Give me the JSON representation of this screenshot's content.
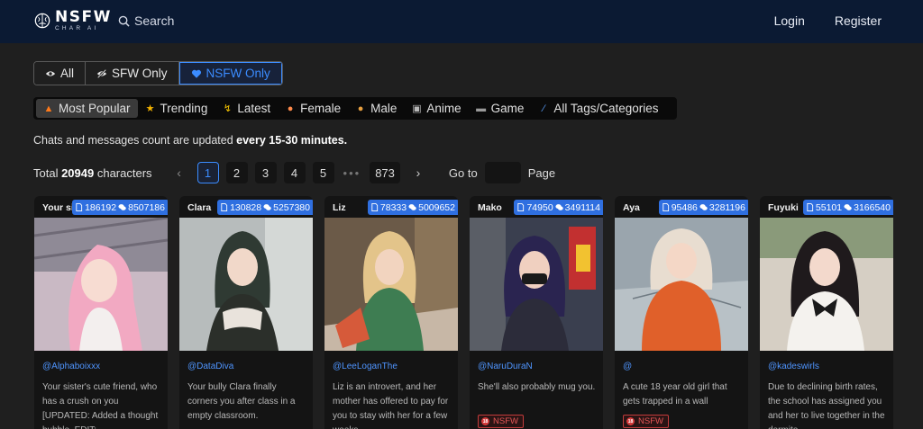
{
  "header": {
    "logo_main": "NSFW",
    "logo_sub": "CHAR AI",
    "search_label": "Search",
    "login": "Login",
    "register": "Register"
  },
  "filters": [
    {
      "label": "All",
      "icon": "eye-icon",
      "active": false
    },
    {
      "label": "SFW Only",
      "icon": "eye-off-icon",
      "active": false
    },
    {
      "label": "NSFW Only",
      "icon": "heart-icon",
      "active": true
    }
  ],
  "sort_tabs": [
    {
      "label": "Most Popular",
      "icon": "fire-icon",
      "active": true
    },
    {
      "label": "Trending",
      "icon": "star-icon",
      "active": false
    },
    {
      "label": "Latest",
      "icon": "lightning-icon",
      "active": false
    },
    {
      "label": "Female",
      "icon": "female-face-icon",
      "active": false
    },
    {
      "label": "Male",
      "icon": "male-face-icon",
      "active": false
    },
    {
      "label": "Anime",
      "icon": "tv-icon",
      "active": false
    },
    {
      "label": "Game",
      "icon": "gamepad-icon",
      "active": false
    },
    {
      "label": "All Tags/Categories",
      "icon": "brush-icon",
      "active": false
    }
  ],
  "info": {
    "prefix": "Chats and messages count are updated ",
    "emphasis": "every 15-30 minutes."
  },
  "pagination": {
    "total_prefix": "Total ",
    "total_count": "20949",
    "total_suffix": " characters",
    "pages": [
      "1",
      "2",
      "3",
      "4",
      "5"
    ],
    "active_page": "1",
    "dots": "•••",
    "last_page": "873",
    "goto_label": "Go to",
    "page_label": "Page"
  },
  "colors": {
    "header_bg": "#0b1a33",
    "accent": "#3b8cff",
    "stats_badge": "#2f6fe0",
    "nsfw_red": "#d43a3a"
  },
  "cards": [
    {
      "name": "Your sist",
      "chats": "186192",
      "messages": "8507186",
      "author": "@Alphaboixxx",
      "desc": "Your sister's cute friend, who has a crush on you [UPDATED: Added a thought bubble. EDIT:",
      "nsfw": false,
      "nsfw_label": ""
    },
    {
      "name": "Clara",
      "chats": "130828",
      "messages": "5257380",
      "author": "@DataDiva",
      "desc": "Your bully Clara finally corners you after class in a empty classroom.",
      "nsfw": false,
      "nsfw_label": ""
    },
    {
      "name": "Liz",
      "chats": "78333",
      "messages": "5009652",
      "author": "@LeeLoganThe",
      "desc": "Liz is an introvert, and her mother has offered to pay for you to stay with her for a few weeks",
      "nsfw": false,
      "nsfw_label": ""
    },
    {
      "name": "Mako",
      "chats": "74950",
      "messages": "3491114",
      "author": "@NaruDuraN",
      "desc": "She'll also probably mug you.",
      "nsfw": true,
      "nsfw_label": "NSFW"
    },
    {
      "name": "Aya",
      "chats": "95486",
      "messages": "3281196",
      "author": "@",
      "desc": "A cute 18 year old girl that gets trapped in a wall",
      "nsfw": true,
      "nsfw_label": "NSFW"
    },
    {
      "name": "Fuyuki",
      "chats": "55101",
      "messages": "3166540",
      "author": "@kadeswirls",
      "desc": "Due to declining birth rates, the school has assigned you and her to live together in the dormito",
      "nsfw": false,
      "nsfw_label": ""
    }
  ]
}
